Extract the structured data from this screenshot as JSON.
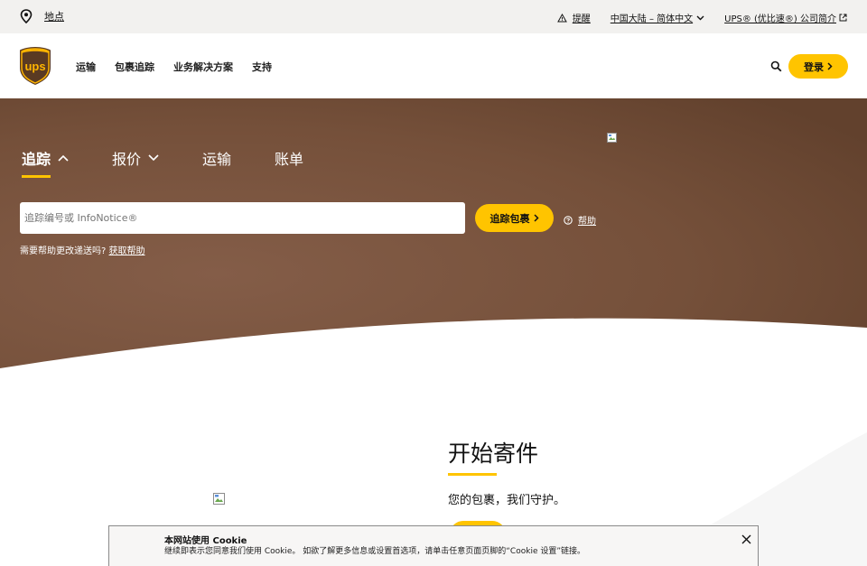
{
  "utility": {
    "location_label": "地点",
    "alerts_label": "提醒",
    "language_label": "中国大陆 – 简体中文",
    "about_label": "UPS® (优比速®) 公司简介"
  },
  "header": {
    "nav": [
      "运输",
      "包裹追踪",
      "业务解决方案",
      "支持"
    ],
    "login_label": "登录"
  },
  "hero": {
    "tabs": [
      "追踪",
      "报价",
      "运输",
      "账单"
    ],
    "tracking_placeholder": "追踪编号或 InfoNotice®",
    "track_button": "追踪包裹",
    "help_label": "帮助",
    "change_prompt": "需要帮助更改递送吗?",
    "change_link": "获取帮助"
  },
  "ship": {
    "title": "开始寄件",
    "subtitle": "您的包裹，我们守护。"
  },
  "cookie": {
    "title": "本网站使用 Cookie",
    "text": "继续即表示您同意我们使用 Cookie。 如欲了解更多信息或设置首选项，请单击任意页面页脚的“Cookie 设置”链接。"
  },
  "colors": {
    "brand_yellow": "#ffc400",
    "brand_brown": "#6b4631",
    "utility_bg": "#f2f1ef"
  },
  "icons": [
    "location-pin-icon",
    "warning-icon",
    "chevron-down-icon",
    "external-link-icon",
    "ups-logo",
    "search-icon",
    "chevron-right-icon",
    "chevron-up-icon",
    "help-circle-icon",
    "broken-image-icon",
    "close-icon"
  ]
}
